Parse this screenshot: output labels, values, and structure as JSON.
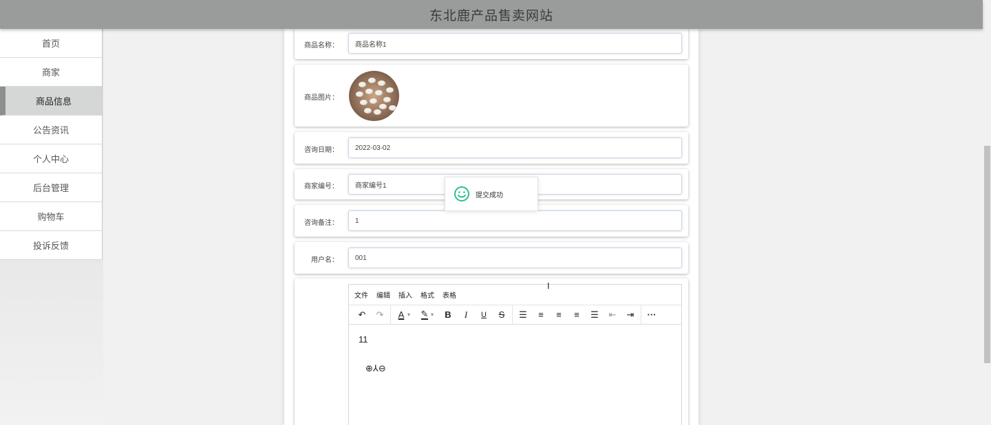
{
  "header": {
    "title": "东北鹿产品售卖网站"
  },
  "sidebar": {
    "items": [
      {
        "label": "首页"
      },
      {
        "label": "商家"
      },
      {
        "label": "商品信息"
      },
      {
        "label": "公告资讯"
      },
      {
        "label": "个人中心"
      },
      {
        "label": "后台管理"
      },
      {
        "label": "购物车"
      },
      {
        "label": "投诉反馈"
      }
    ],
    "active_index": 2
  },
  "form": {
    "product_name": {
      "label": "商品名称：",
      "value": "商品名称1"
    },
    "product_image": {
      "label": "商品图片："
    },
    "inquiry_date": {
      "label": "咨询日期：",
      "value": "2022-03-02"
    },
    "merchant_id": {
      "label": "商家编号：",
      "value": "商家编号1"
    },
    "inquiry_note": {
      "label": "咨询备注：",
      "value": "1"
    },
    "username": {
      "label": "用户名：",
      "value": "001"
    }
  },
  "editor": {
    "menu": [
      "文件",
      "编辑",
      "插入",
      "格式",
      "表格"
    ],
    "content_line1": "11",
    "content_line2": "⊕⅄⊖"
  },
  "toast": {
    "text": "提交成功"
  },
  "colors": {
    "header_bg": "#9a9c9c",
    "toast_icon": "#2dbf8a",
    "active_bar": "#8e9090"
  }
}
